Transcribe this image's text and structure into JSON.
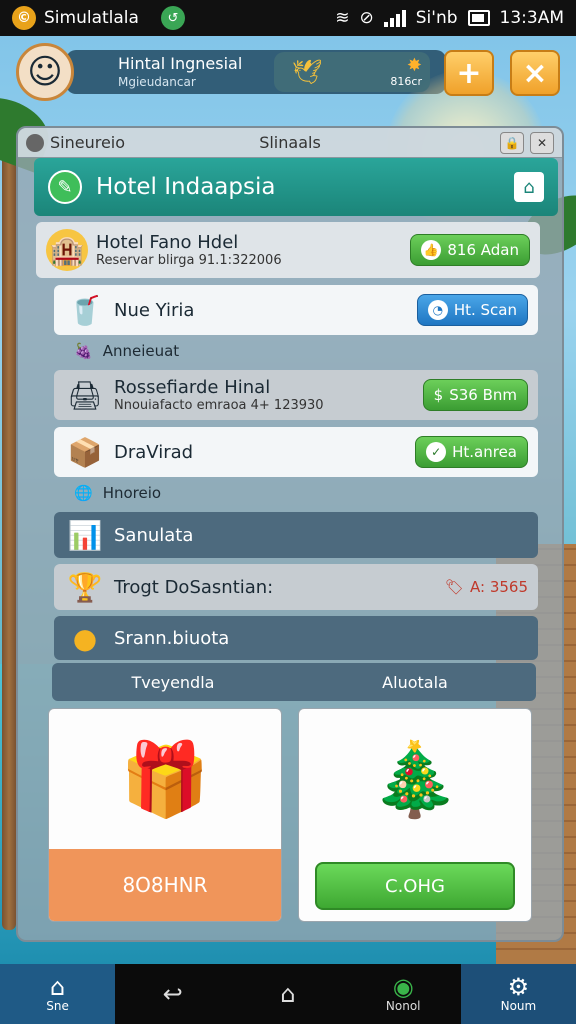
{
  "status_bar": {
    "app_name": "Simulatlala",
    "time": "13:3AM",
    "signal_text": "Si'nb"
  },
  "header": {
    "profile_name": "Hintal Ingnesial",
    "profile_sub": "Mgieudancar",
    "resource_amount": "816cr",
    "plus_label": "+",
    "close_label": "×"
  },
  "panel": {
    "window_left": "Sineureio",
    "window_title": "Slinaals",
    "hotel_title": "Hotel Indaapsia"
  },
  "rows": [
    {
      "name": "Hotel Fano Hdel",
      "sub": "Reservar blirga 91.1:322006",
      "button": "816 Adan"
    },
    {
      "name": "Nue Yiria",
      "button": "Ht. Scan"
    },
    {
      "label": "Anneieuat"
    },
    {
      "name": "Rossefiarde Hinal",
      "sub": "Nnouiafacto emraoa 4+ 123930",
      "button": "S36 Bnm"
    },
    {
      "name": "DraVirad",
      "button": "Ht.anrea"
    },
    {
      "label": "Hnoreio"
    },
    {
      "name": "Sanulata"
    },
    {
      "name": "Trogt DoSasntian:",
      "price": "A: 3565"
    },
    {
      "name": "Srann.biuota"
    }
  ],
  "tabs": [
    "Tveyendla",
    "Aluotala"
  ],
  "cards": [
    {
      "button": "8O8HNR"
    },
    {
      "button": "C.OHG"
    }
  ],
  "bottom_nav": [
    {
      "label": "Sne"
    },
    {
      "label": ""
    },
    {
      "label": ""
    },
    {
      "label": "Nonol"
    },
    {
      "label": "Noum"
    }
  ],
  "colors": {
    "teal_header": "#1b8579",
    "green_button": "#3b9d33",
    "blue_button": "#1f76c2",
    "orange_card": "#f0955a",
    "green_card": "#4cbf3d"
  }
}
